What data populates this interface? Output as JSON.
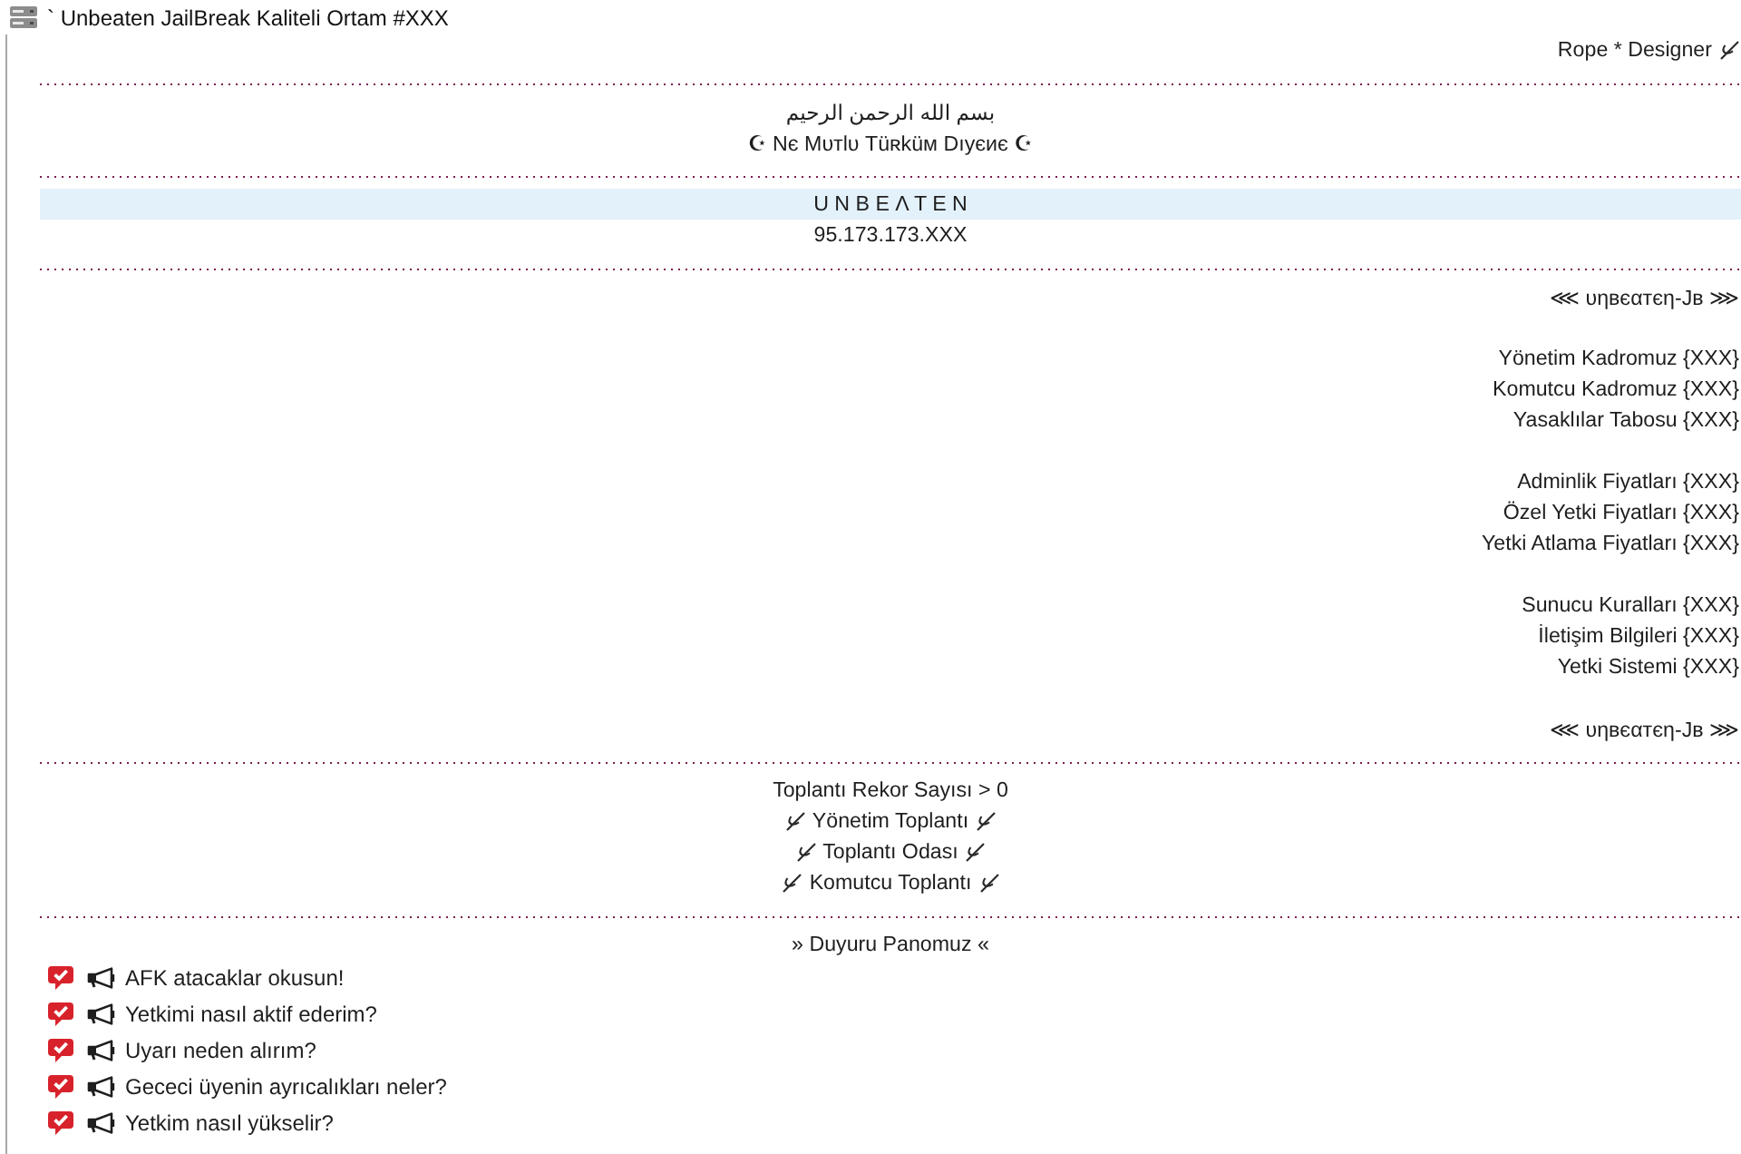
{
  "server": {
    "title": "` Unbeaten JailBreak Kaliteli Ortam #XXX"
  },
  "channels": [
    {
      "kind": "right",
      "label": "Rope * Designer",
      "mark_after": true,
      "selected": false
    },
    {
      "kind": "dots",
      "selected": false
    },
    {
      "kind": "center",
      "label": "بسم الله الرحمن الرحيم",
      "selected": false
    },
    {
      "kind": "center",
      "label": "☪ Nє Mυтlυ Tüʀküм Dıуєиє ☪",
      "selected": false
    },
    {
      "kind": "dots",
      "selected": false
    },
    {
      "kind": "center",
      "label": "U N B E Λ T E N",
      "selected": true
    },
    {
      "kind": "center",
      "label": "95.173.173.XXX",
      "selected": false
    },
    {
      "kind": "dots",
      "selected": false
    },
    {
      "kind": "right",
      "label": "⋘ υηвєαтєη-Jв ⋙",
      "selected": false
    },
    {
      "kind": "blank"
    },
    {
      "kind": "right",
      "label": "Yönetim Kadromuz {XXX}",
      "selected": false
    },
    {
      "kind": "right",
      "label": "Komutcu Kadromuz {XXX}",
      "selected": false
    },
    {
      "kind": "right",
      "label": "Yasaklılar Tabosu {XXX}",
      "selected": false
    },
    {
      "kind": "blank"
    },
    {
      "kind": "right",
      "label": "Adminlik Fiyatları {XXX}",
      "selected": false
    },
    {
      "kind": "right",
      "label": "Özel Yetki Fiyatları {XXX}",
      "selected": false
    },
    {
      "kind": "right",
      "label": "Yetki Atlama Fiyatları {XXX}",
      "selected": false
    },
    {
      "kind": "blank"
    },
    {
      "kind": "right",
      "label": "Sunucu Kuralları {XXX}",
      "selected": false
    },
    {
      "kind": "right",
      "label": "İletişim Bilgileri {XXX}",
      "selected": false
    },
    {
      "kind": "right",
      "label": "Yetki Sistemi {XXX}",
      "selected": false
    },
    {
      "kind": "blank"
    },
    {
      "kind": "right",
      "label": "⋘ υηвєαтєη-Jв ⋙",
      "selected": false
    },
    {
      "kind": "dots",
      "selected": false
    },
    {
      "kind": "center",
      "label": "Toplantı Rekor Sayısı > 0",
      "selected": false
    },
    {
      "kind": "center",
      "label": "Yönetim Toplantı",
      "mark_before": true,
      "mark_after": true,
      "selected": false
    },
    {
      "kind": "center",
      "label": "Toplantı Odası",
      "mark_before": true,
      "mark_after": true,
      "selected": false
    },
    {
      "kind": "center",
      "label": "Komutcu Toplantı",
      "mark_before": true,
      "mark_after": true,
      "selected": false
    },
    {
      "kind": "dots",
      "selected": false
    },
    {
      "kind": "center",
      "label": "» Duyuru Panomuz «",
      "selected": false
    }
  ],
  "announcements": [
    {
      "label": "AFK atacaklar okusun!",
      "selected": false
    },
    {
      "label": "Yetkimi nasıl aktif ederim?",
      "selected": false
    },
    {
      "label": "Uyarı neden alırım?",
      "selected": false
    },
    {
      "label": "Gececi üyenin ayrıcalıkları neler?",
      "selected": false
    },
    {
      "label": "Yetkim nasıl yükselir?",
      "selected": false
    }
  ]
}
